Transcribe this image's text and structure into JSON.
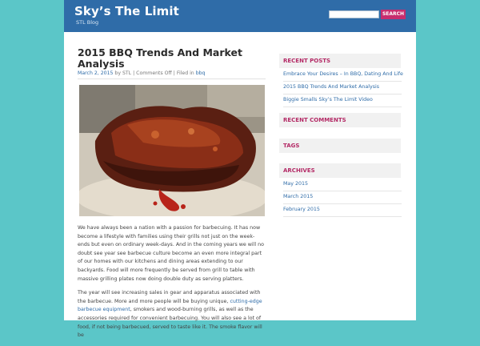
{
  "header": {
    "site_title": "Sky’s The Limit",
    "tagline": "STL Blog",
    "search_button_label": "SEARCH"
  },
  "post": {
    "title": "2015 BBQ Trends And Market Analysis",
    "date": "March 2, 2015",
    "by": "by STL",
    "comments": "Comments Off",
    "filed_in": "Filed in",
    "category": "bbq",
    "p1": "We have always been a nation with a passion for barbecuing. It has now become a lifestyle with families using their grills not just on the week-ends but even on ordinary week-days. And in the coming years we will no doubt see year see barbecue culture become an even more integral part of our homes with our kitchens and dining areas extending to our backyards. Food will more frequently be served from grill to table with massive grilling plates now doing double duty as serving platters.",
    "p2_before": "The year will see increasing sales in gear and apparatus associated with the barbecue. More and more people will be buying unique,",
    "p2_link": "cutting-edge barbecue equipment",
    "p2_after": ", smokers and wood-burning grills, as well as the accessories required for convenient barbecuing. You will also see a lot of food, if not being barbecued, served to taste like it. The smoke flavor will be"
  },
  "sidebar": {
    "recent_posts_title": "RECENT POSTS",
    "recent_posts": [
      "Embrace Your Desires – In BBQ, Dating And Life",
      "2015 BBQ Trends And Market Analysis",
      "Biggie Smalls Sky’s The Limit Video"
    ],
    "recent_comments_title": "RECENT COMMENTS",
    "tags_title": "TAGS",
    "archives_title": "ARCHIVES",
    "archives": [
      "May 2015",
      "March 2015",
      "February 2015"
    ]
  },
  "colors": {
    "page_background": "#5bc6c8",
    "header_background": "#2f6ca8",
    "accent_pink": "#c72d6e",
    "link_blue": "#2f6ca8",
    "widget_title": "#b42a66"
  }
}
